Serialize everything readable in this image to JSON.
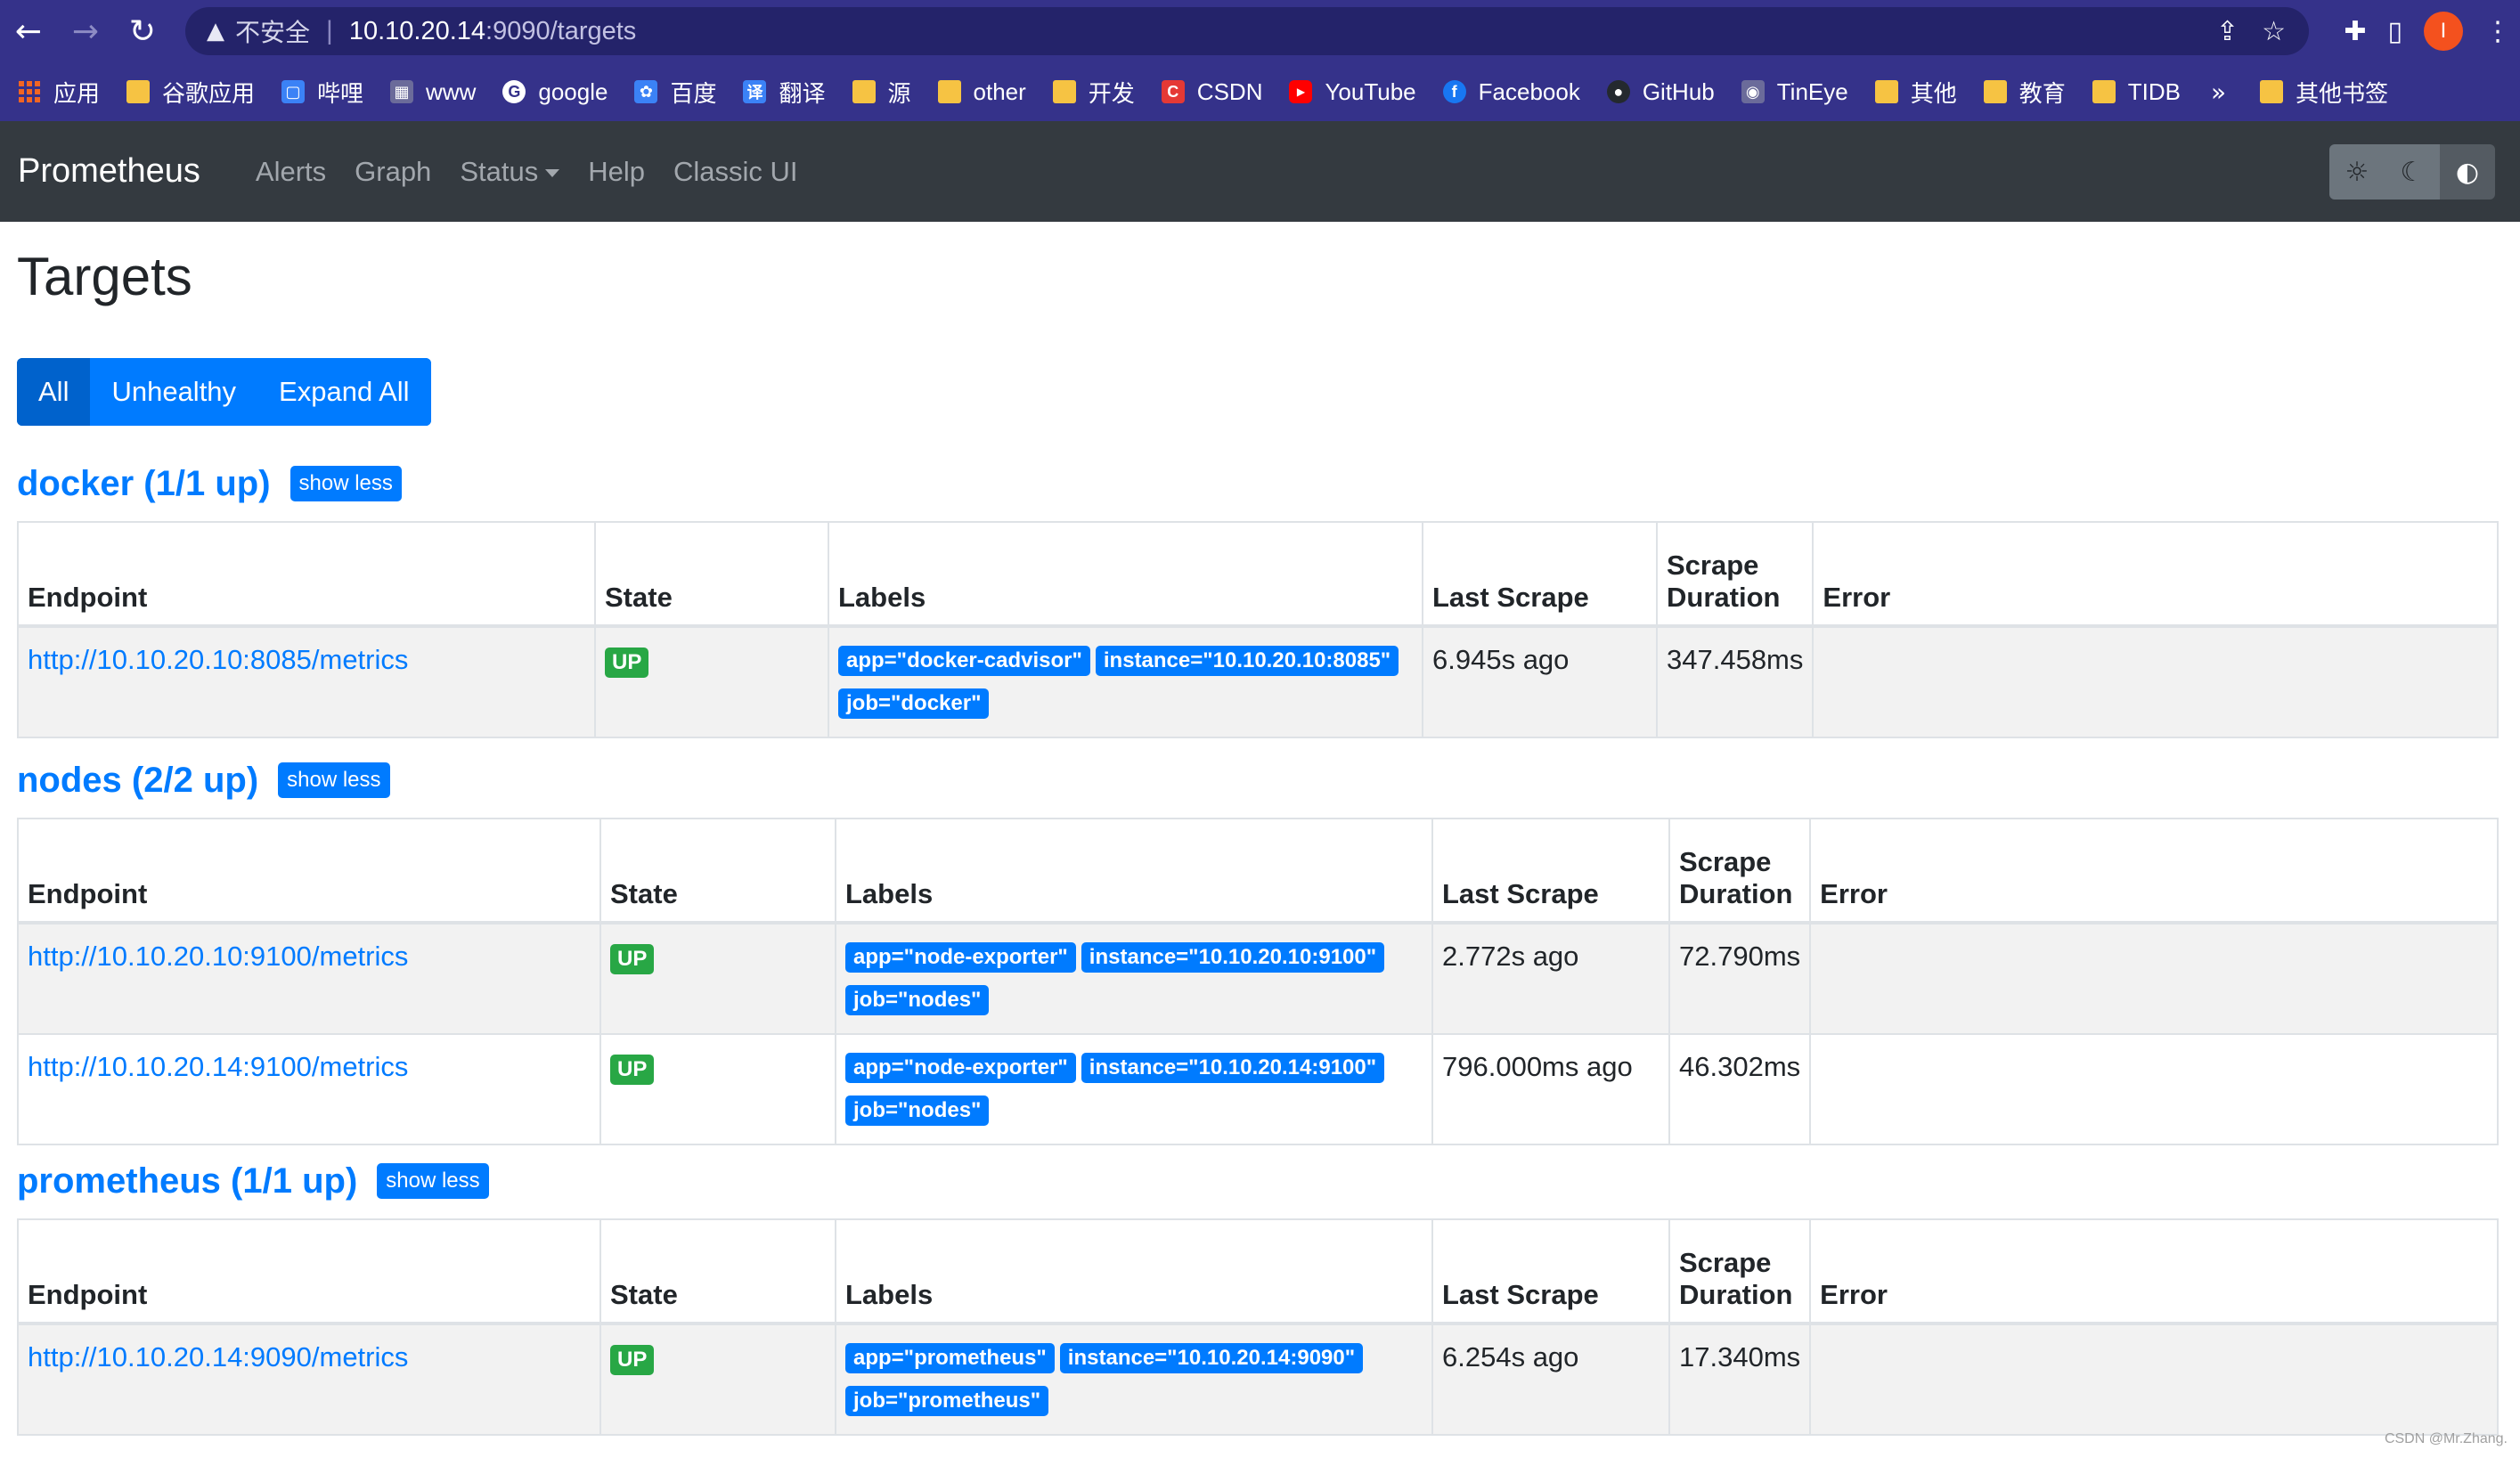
{
  "browser": {
    "url_warning_label": "不安全",
    "url_host": "10.10.20.14",
    "url_path": ":9090/targets",
    "profile_initial": "I",
    "bookmarks": [
      {
        "label": "应用",
        "icon": "apps-grid-icon"
      },
      {
        "label": "谷歌应用",
        "icon": "folder-icon"
      },
      {
        "label": "哔哩",
        "icon": "bilibili-icon"
      },
      {
        "label": "www",
        "icon": "site-icon"
      },
      {
        "label": "google",
        "icon": "google-icon"
      },
      {
        "label": "百度",
        "icon": "baidu-icon"
      },
      {
        "label": "翻译",
        "icon": "translate-icon"
      },
      {
        "label": "源",
        "icon": "folder-icon"
      },
      {
        "label": "other",
        "icon": "folder-icon"
      },
      {
        "label": "开发",
        "icon": "folder-icon"
      },
      {
        "label": "CSDN",
        "icon": "csdn-icon"
      },
      {
        "label": "YouTube",
        "icon": "youtube-icon"
      },
      {
        "label": "Facebook",
        "icon": "facebook-icon"
      },
      {
        "label": "GitHub",
        "icon": "github-icon"
      },
      {
        "label": "TinEye",
        "icon": "tineye-icon"
      },
      {
        "label": "其他",
        "icon": "folder-icon"
      },
      {
        "label": "教育",
        "icon": "folder-icon"
      },
      {
        "label": "TIDB",
        "icon": "folder-icon"
      }
    ],
    "other_bookmarks_label": "其他书签",
    "more_label": "»",
    "accent_color": "#35328a"
  },
  "navbar": {
    "brand": "Prometheus",
    "links": [
      "Alerts",
      "Graph",
      "Status",
      "Help",
      "Classic UI"
    ],
    "background": "#343a40"
  },
  "page": {
    "title": "Targets",
    "filters": [
      "All",
      "Unhealthy",
      "Expand All"
    ],
    "active_filter": "All"
  },
  "columns": [
    "Endpoint",
    "State",
    "Labels",
    "Last Scrape",
    "Scrape Duration",
    "Error"
  ],
  "show_less_label": "show less",
  "sections": [
    {
      "title": "docker (1/1 up)",
      "rows": [
        {
          "endpoint": "http://10.10.20.10:8085/metrics",
          "state": "UP",
          "labels": [
            "app=\"docker-cadvisor\"",
            "instance=\"10.10.20.10:8085\"",
            "job=\"docker\""
          ],
          "last_scrape": "6.945s ago",
          "duration": "347.458ms",
          "error": ""
        }
      ]
    },
    {
      "title": "nodes (2/2 up)",
      "rows": [
        {
          "endpoint": "http://10.10.20.10:9100/metrics",
          "state": "UP",
          "labels": [
            "app=\"node-exporter\"",
            "instance=\"10.10.20.10:9100\"",
            "job=\"nodes\""
          ],
          "last_scrape": "2.772s ago",
          "duration": "72.790ms",
          "error": ""
        },
        {
          "endpoint": "http://10.10.20.14:9100/metrics",
          "state": "UP",
          "labels": [
            "app=\"node-exporter\"",
            "instance=\"10.10.20.14:9100\"",
            "job=\"nodes\""
          ],
          "last_scrape": "796.000ms ago",
          "duration": "46.302ms",
          "error": ""
        }
      ]
    },
    {
      "title": "prometheus (1/1 up)",
      "rows": [
        {
          "endpoint": "http://10.10.20.14:9090/metrics",
          "state": "UP",
          "labels": [
            "app=\"prometheus\"",
            "instance=\"10.10.20.14:9090\"",
            "job=\"prometheus\""
          ],
          "last_scrape": "6.254s ago",
          "duration": "17.340ms",
          "error": ""
        }
      ]
    }
  ],
  "watermark": "CSDN @Mr.Zhang.",
  "colors": {
    "link": "#007bff",
    "up_badge": "#28a745",
    "label_badge": "#007bff"
  }
}
